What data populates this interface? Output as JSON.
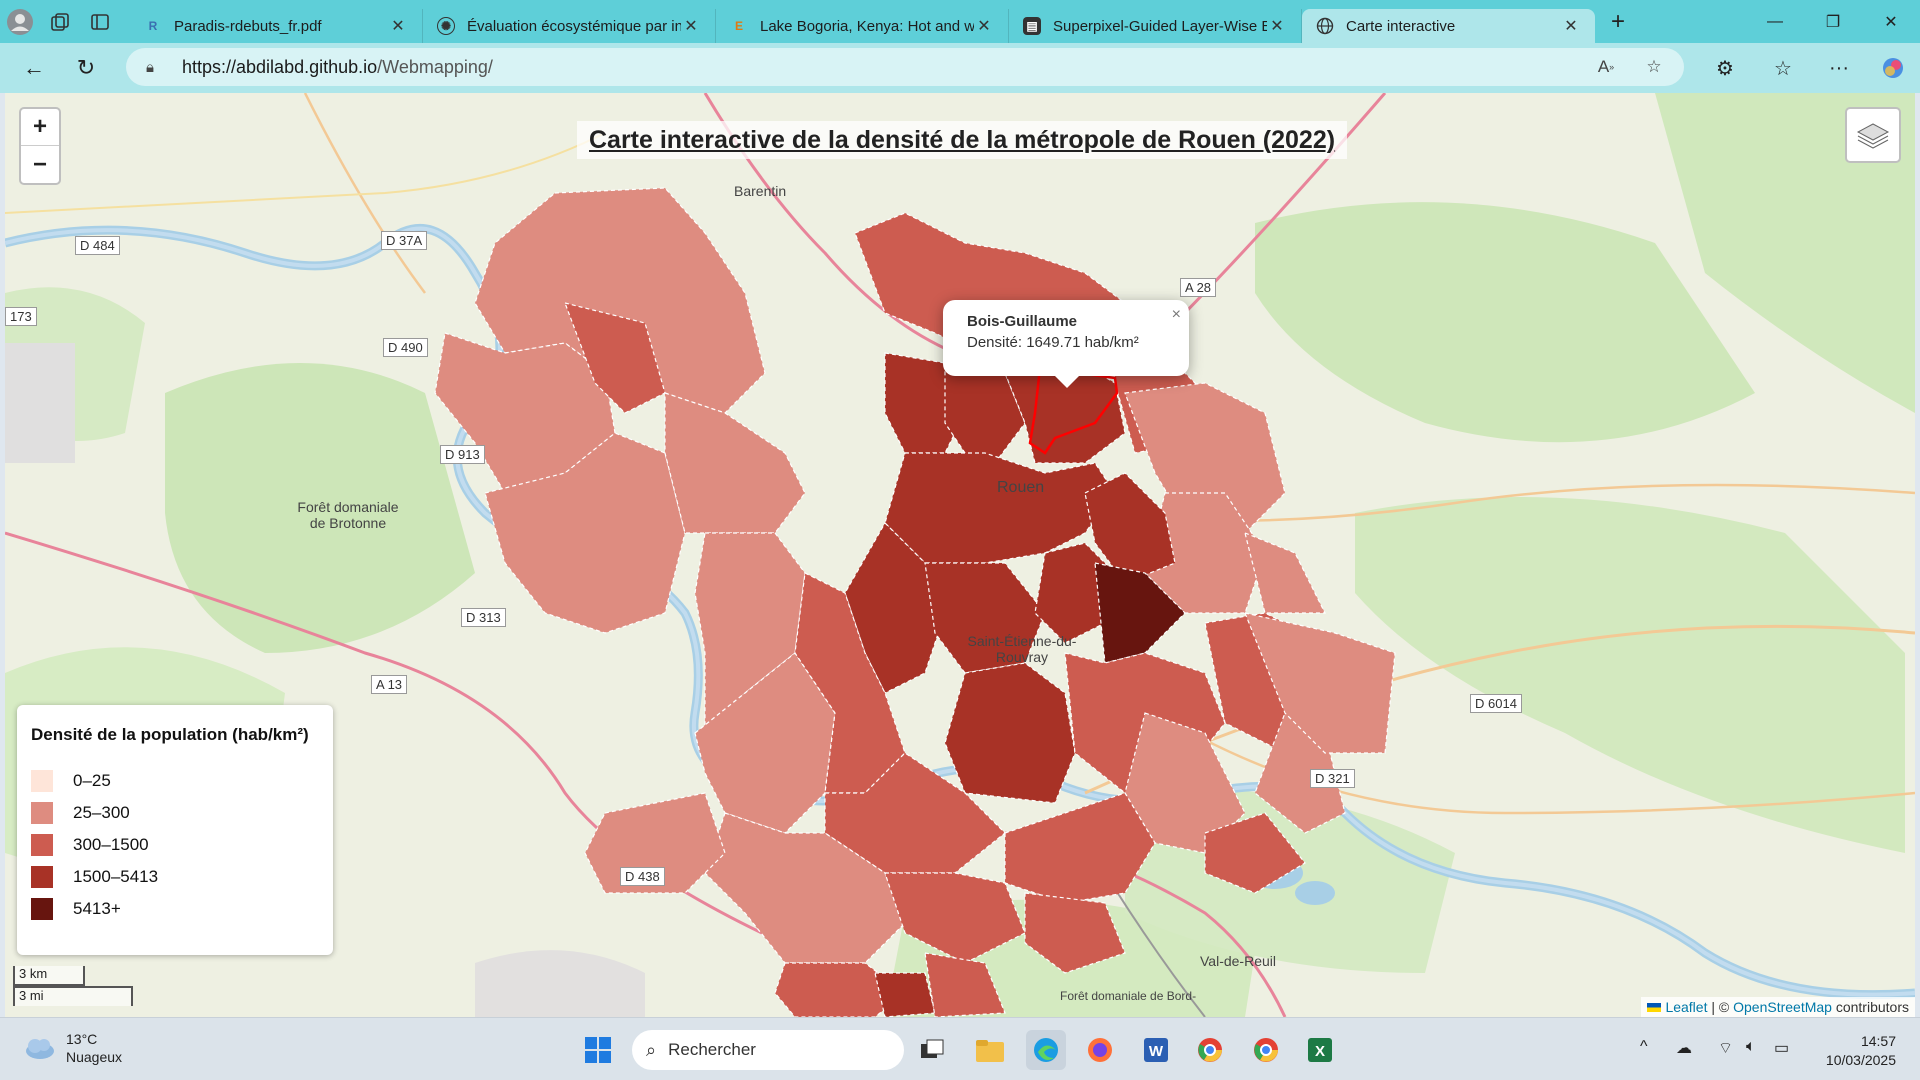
{
  "browser": {
    "tabs": [
      {
        "title": "Paradis-rdebuts_fr.pdf",
        "icon": "pdf-reader-icon",
        "active": false
      },
      {
        "title": "Évaluation écosystémique par ind",
        "icon": "openai-icon",
        "active": false
      },
      {
        "title": "Lake Bogoria, Kenya: Hot and war",
        "icon": "e-letter-icon",
        "active": false
      },
      {
        "title": "Superpixel-Guided Layer-Wise En",
        "icon": "paper-icon",
        "active": false
      },
      {
        "title": "Carte interactive",
        "icon": "globe-icon",
        "active": true
      }
    ],
    "url_host": "https://abdilabd.github.io",
    "url_path": "/Webmapping/"
  },
  "map": {
    "title": "Carte interactive de la densité de la métropole de Rouen (2022)",
    "zoom_in": "+",
    "zoom_out": "−",
    "popup": {
      "name": "Bois-Guillaume",
      "density": "Densité: 1649.71 hab/km²",
      "close": "×"
    },
    "legend": {
      "title": "Densité de la population (hab/km²)",
      "items": [
        {
          "label": "0–25",
          "color": "#fee5d9"
        },
        {
          "label": "25–300",
          "color": "#de8c80"
        },
        {
          "label": "300–1500",
          "color": "#cd5c50"
        },
        {
          "label": "1500–5413",
          "color": "#a83226"
        },
        {
          "label": "5413+",
          "color": "#67150f"
        }
      ]
    },
    "scale": {
      "km": "3 km",
      "mi": "3 mi"
    },
    "attribution": {
      "leaflet": "Leaflet",
      "sep": " | © ",
      "osm": "OpenStreetMap",
      "rest": " contributors"
    },
    "road_labels": [
      "D 484",
      "D 37A",
      "D 490",
      "D 913",
      "D 313",
      "A 13",
      "D 438",
      "A 28",
      "D 6014",
      "D 321",
      "173"
    ],
    "place_labels": [
      "Barentin",
      "Forêt domaniale de Brotonne",
      "Rouen",
      "Saint-Étienne-du-Rouvray",
      "Val-de-Reuil",
      "Forêt domaniale de Bord-"
    ]
  },
  "taskbar": {
    "weather_temp": "13°C",
    "weather_desc": "Nuageux",
    "search_placeholder": "Rechercher",
    "time": "14:57",
    "date": "10/03/2025"
  }
}
